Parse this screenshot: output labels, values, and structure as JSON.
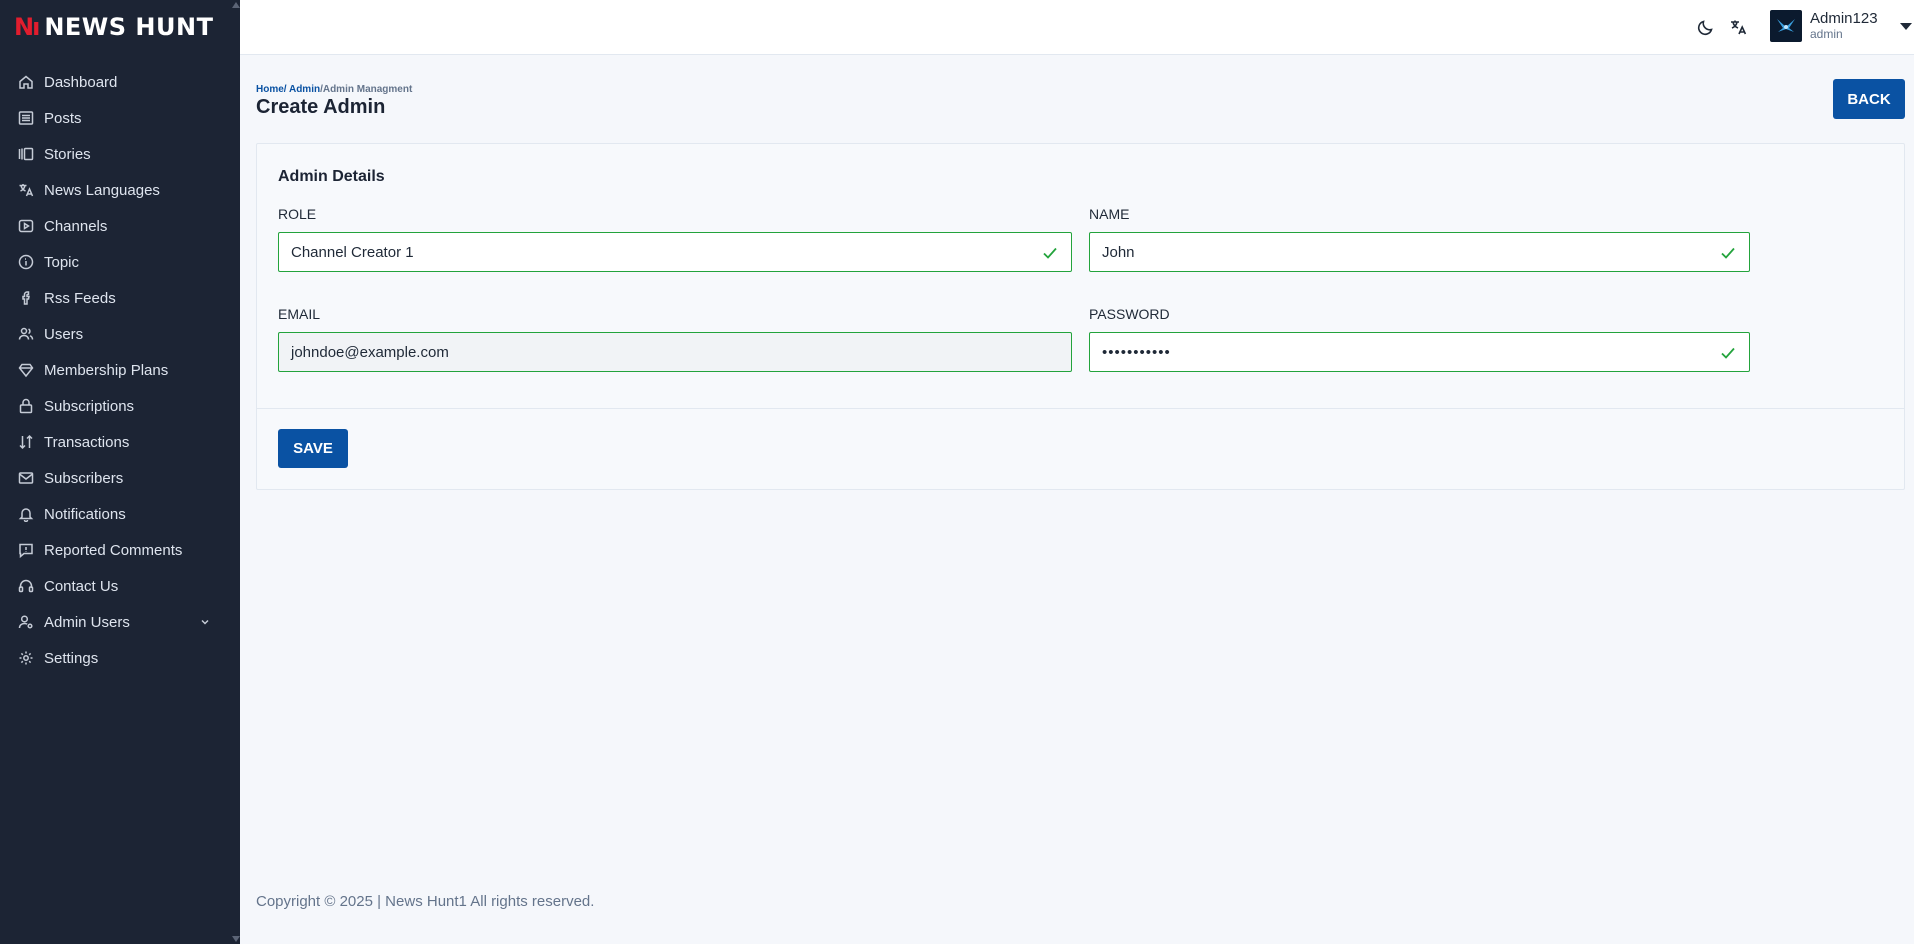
{
  "brand": {
    "logo": "Nı",
    "name": "NEWS HUNT"
  },
  "sidebar": {
    "items": [
      {
        "label": "Dashboard",
        "icon": "home-icon"
      },
      {
        "label": "Posts",
        "icon": "list-icon"
      },
      {
        "label": "Stories",
        "icon": "stories-icon"
      },
      {
        "label": "News Languages",
        "icon": "translate-icon"
      },
      {
        "label": "Channels",
        "icon": "play-icon"
      },
      {
        "label": "Topic",
        "icon": "info-icon"
      },
      {
        "label": "Rss Feeds",
        "icon": "facebook-icon"
      },
      {
        "label": "Users",
        "icon": "users-icon"
      },
      {
        "label": "Membership Plans",
        "icon": "diamond-icon"
      },
      {
        "label": "Subscriptions",
        "icon": "lock-icon"
      },
      {
        "label": "Transactions",
        "icon": "transfer-icon"
      },
      {
        "label": "Subscribers",
        "icon": "mail-icon"
      },
      {
        "label": "Notifications",
        "icon": "bell-icon"
      },
      {
        "label": "Reported Comments",
        "icon": "comment-alert-icon"
      },
      {
        "label": "Contact Us",
        "icon": "headset-icon"
      },
      {
        "label": "Admin Users",
        "icon": "user-cog-icon"
      },
      {
        "label": "Settings",
        "icon": "gear-icon"
      }
    ]
  },
  "header": {
    "user_name": "Admin123",
    "user_role": "admin"
  },
  "breadcrumb": {
    "home": "Home/",
    "admin": " Admin",
    "current": "/Admin Managment"
  },
  "page_title": "Create Admin",
  "back_label": "BACK",
  "form": {
    "title": "Admin Details",
    "role_label": "ROLE",
    "role_value": "Channel Creator 1",
    "name_label": "NAME",
    "name_value": "John",
    "email_label": "EMAIL",
    "email_value": "johndoe@example.com",
    "password_label": "PASSWORD",
    "password_value": "•••••••••••",
    "save_label": "SAVE"
  },
  "footer": "Copyright © 2025 | News Hunt1 All rights reserved.",
  "colors": {
    "sidebar_bg": "#1c2434",
    "primary": "#0a52a3",
    "valid": "#23a33c",
    "brand_red": "#e11d2e"
  }
}
